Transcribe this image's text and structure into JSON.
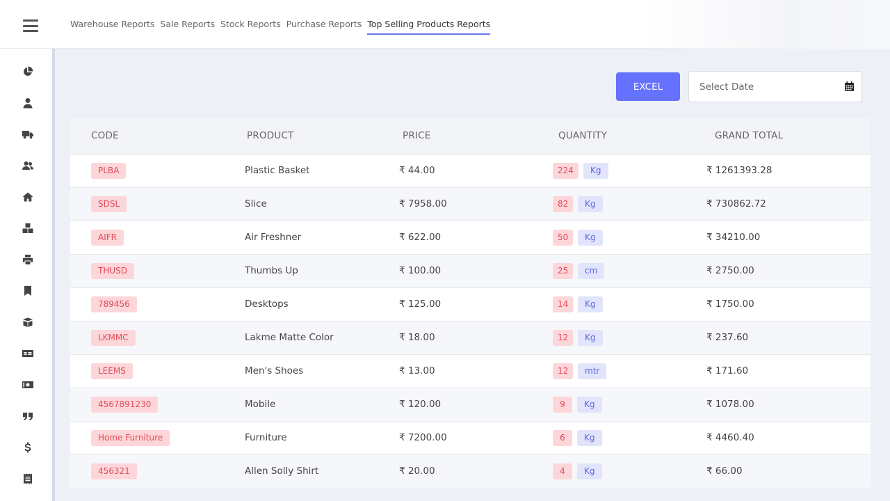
{
  "header": {
    "tabs": [
      {
        "label": "Warehouse Reports"
      },
      {
        "label": "Sale Reports"
      },
      {
        "label": "Stock Reports"
      },
      {
        "label": "Purchase Reports"
      },
      {
        "label": "Top Selling Products Reports",
        "active": true
      }
    ]
  },
  "sidebar": {
    "icons": [
      "pie-chart-icon",
      "user-icon",
      "truck-icon",
      "users-icon",
      "home-icon",
      "boxes-icon",
      "print-icon",
      "bookmark-icon",
      "box-open-icon",
      "id-card-icon",
      "money-bill-icon",
      "quote-icon",
      "dollar-icon",
      "receipt-icon"
    ]
  },
  "toolbar": {
    "excel_label": "EXCEL",
    "date_placeholder": "Select Date"
  },
  "table": {
    "columns": [
      "CODE",
      "PRODUCT",
      "PRICE",
      "QUANTITY",
      "GRAND TOTAL"
    ],
    "rows": [
      {
        "code": "PLBA",
        "product": "Plastic Basket",
        "price": "₹ 44.00",
        "qty": "224",
        "unit": "Kg",
        "total": "₹ 1261393.28"
      },
      {
        "code": "SDSL",
        "product": "Slice",
        "price": "₹ 7958.00",
        "qty": "82",
        "unit": "Kg",
        "total": "₹ 730862.72"
      },
      {
        "code": "AIFR",
        "product": "Air Freshner",
        "price": "₹ 622.00",
        "qty": "50",
        "unit": "Kg",
        "total": "₹ 34210.00"
      },
      {
        "code": "THUSD",
        "product": "Thumbs Up",
        "price": "₹ 100.00",
        "qty": "25",
        "unit": "cm",
        "total": "₹ 2750.00"
      },
      {
        "code": "789456",
        "product": "Desktops",
        "price": "₹ 125.00",
        "qty": "14",
        "unit": "Kg",
        "total": "₹ 1750.00"
      },
      {
        "code": "LKMMC",
        "product": "Lakme Matte Color",
        "price": "₹ 18.00",
        "qty": "12",
        "unit": "Kg",
        "total": "₹ 237.60"
      },
      {
        "code": "LEEMS",
        "product": "Men's Shoes",
        "price": "₹ 13.00",
        "qty": "12",
        "unit": "mtr",
        "total": "₹ 171.60"
      },
      {
        "code": "4567891230",
        "product": "Mobile",
        "price": "₹ 120.00",
        "qty": "9",
        "unit": "Kg",
        "total": "₹ 1078.00"
      },
      {
        "code": "Home Furniture",
        "product": "Furniture",
        "price": "₹ 7200.00",
        "qty": "6",
        "unit": "Kg",
        "total": "₹ 4460.40"
      },
      {
        "code": "456321",
        "product": "Allen Solly Shirt",
        "price": "₹ 20.00",
        "qty": "4",
        "unit": "Kg",
        "total": "₹ 66.00"
      }
    ]
  }
}
